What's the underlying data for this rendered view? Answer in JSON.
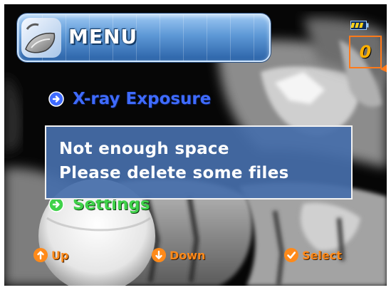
{
  "menu": {
    "title": "MENU"
  },
  "status": {
    "battery_icon": "battery-icon",
    "counter_value": "0"
  },
  "items": [
    {
      "label": "X-ray Exposure",
      "icon": "arrow-right-circle-icon",
      "color": "#3f6bff"
    },
    {
      "label": "Settings",
      "icon": "arrow-right-circle-icon",
      "color": "#3fd24a"
    }
  ],
  "dialog": {
    "line1": "Not enough space",
    "line2": "Please delete some files"
  },
  "hints": [
    {
      "label": "Up",
      "icon": "arrow-up-circle-icon"
    },
    {
      "label": "Down",
      "icon": "arrow-down-circle-icon"
    },
    {
      "label": "Select",
      "icon": "check-circle-icon"
    }
  ],
  "colors": {
    "accent_orange": "#ff7a1a",
    "menu_blue": "#5d98d6",
    "dialog_bg": "#466eaa"
  }
}
